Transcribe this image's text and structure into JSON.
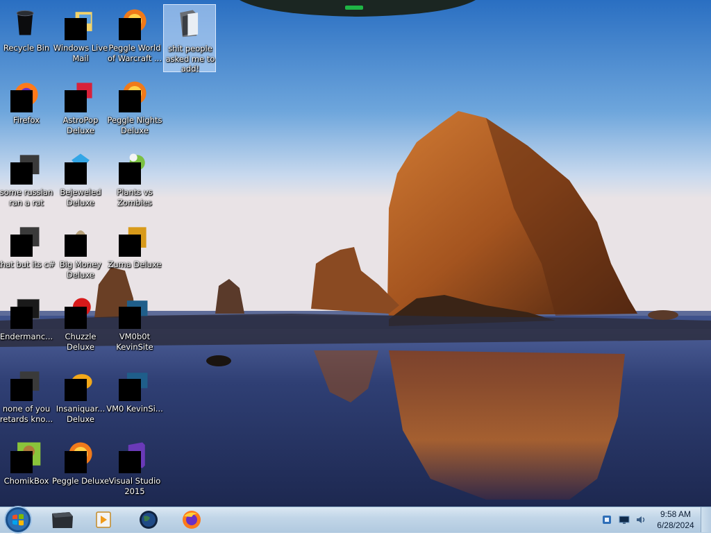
{
  "desktop": {
    "icons": [
      {
        "label": "Recycle Bin",
        "icon": "recycle-bin-icon",
        "redacted": false
      },
      {
        "label": "Windows Live Mail",
        "icon": "mail-icon",
        "redacted": true
      },
      {
        "label": "Peggle World of Warcraft ...",
        "icon": "peggle-icon",
        "redacted": true
      },
      {
        "label": "shit people asked me to add!",
        "icon": "folder-icon",
        "redacted": false,
        "selected": true
      },
      {
        "label": "Firefox",
        "icon": "firefox-icon",
        "redacted": true
      },
      {
        "label": "AstroPop Deluxe",
        "icon": "game-icon",
        "redacted": true
      },
      {
        "label": "Peggle Nights Deluxe",
        "icon": "peggle-icon",
        "redacted": true
      },
      {
        "label": "some russian ran a rat",
        "icon": "app-icon",
        "redacted": true
      },
      {
        "label": "Bejeweled Deluxe",
        "icon": "gem-icon",
        "redacted": true
      },
      {
        "label": "Plants vs Zombies",
        "icon": "plant-icon",
        "redacted": true
      },
      {
        "label": "that but its c#",
        "icon": "app-icon",
        "redacted": true
      },
      {
        "label": "Big Money Deluxe",
        "icon": "money-bag-icon",
        "redacted": true
      },
      {
        "label": "Zuma Deluxe",
        "icon": "zuma-icon",
        "redacted": true
      },
      {
        "label": "Endermanc...",
        "icon": "terminal-icon",
        "redacted": true
      },
      {
        "label": "Chuzzle Deluxe",
        "icon": "chuzzle-icon",
        "redacted": true
      },
      {
        "label": "VM0b0t KevinSite",
        "icon": "vm-icon",
        "redacted": true
      },
      {
        "label": "none of you retards kno...",
        "icon": "app-icon",
        "redacted": true
      },
      {
        "label": "Insaniquar... Deluxe",
        "icon": "fish-icon",
        "redacted": true
      },
      {
        "label": "VM0 KevinSi...",
        "icon": "vm-icon",
        "redacted": true
      },
      {
        "label": "ChomikBox",
        "icon": "chomikbox-icon",
        "redacted": true
      },
      {
        "label": "Peggle Deluxe",
        "icon": "peggle-icon",
        "redacted": true
      },
      {
        "label": "Visual Studio 2015",
        "icon": "visual-studio-icon",
        "redacted": true
      }
    ]
  },
  "taskbar": {
    "start_icon": "windows-orb-icon",
    "pinned": [
      {
        "name": "folder-dark-icon"
      },
      {
        "name": "media-player-icon"
      },
      {
        "name": "globe-icon"
      },
      {
        "name": "firefox-icon"
      }
    ],
    "tray_icons": [
      "shield-flag-icon",
      "network-monitor-icon",
      "volume-icon"
    ],
    "clock": {
      "time": "9:58 AM",
      "date": "6/28/2024"
    }
  },
  "colors": {
    "sky_top": "#2a6fc2",
    "sky_horizon": "#e9e3e6",
    "rock": "#a4541f",
    "water": "#27345e",
    "taskbar": "#c2d6e8"
  }
}
